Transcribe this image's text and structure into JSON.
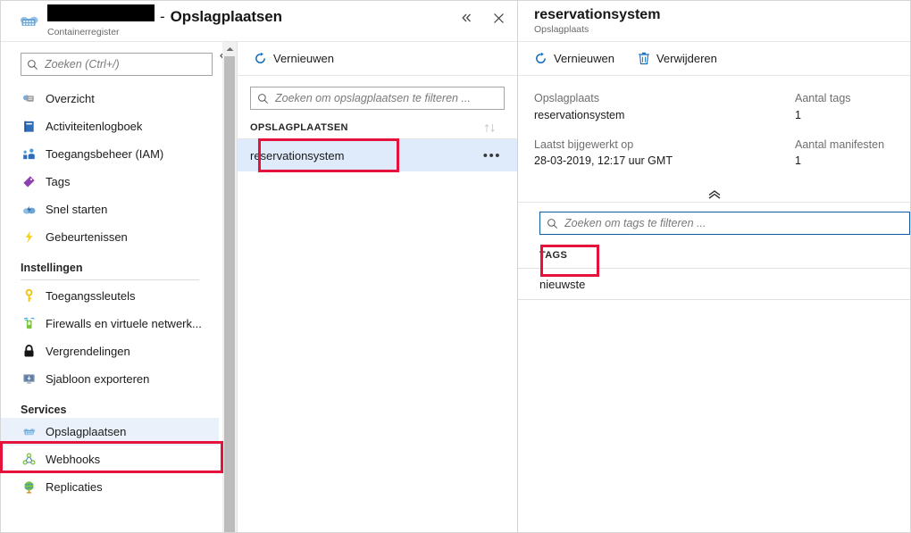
{
  "left_blade": {
    "header": {
      "icon": "container-registry-icon",
      "redacted_name": "",
      "separator": "-",
      "title": "Opslagplaatsen",
      "subtitle": "Containerregister",
      "collapse_label": "«",
      "close_label": "✕"
    },
    "menu": {
      "collapse_label": "«",
      "search": {
        "placeholder": "Zoeken (Ctrl+/)",
        "value": "",
        "icon": "search-icon"
      },
      "items": [
        {
          "label": "Overzicht",
          "icon": "overview-icon",
          "selected": false
        },
        {
          "label": "Activiteitenlogboek",
          "icon": "activity-log-icon",
          "selected": false
        },
        {
          "label": "Toegangsbeheer (IAM)",
          "icon": "access-control-icon",
          "selected": false
        },
        {
          "label": "Tags",
          "icon": "tag-icon",
          "selected": false
        },
        {
          "label": "Snel starten",
          "icon": "quickstart-icon",
          "selected": false
        },
        {
          "label": "Gebeurtenissen",
          "icon": "events-icon",
          "selected": false
        }
      ],
      "group_settings": "Instellingen",
      "settings_items": [
        {
          "label": "Toegangssleutels",
          "icon": "key-icon",
          "selected": false
        },
        {
          "label": "Firewalls en virtuele netwerk...",
          "icon": "firewall-icon",
          "selected": false
        },
        {
          "label": "Vergrendelingen",
          "icon": "lock-icon",
          "selected": false
        },
        {
          "label": "Sjabloon exporteren",
          "icon": "export-template-icon",
          "selected": false
        }
      ],
      "group_services": "Services",
      "services_items": [
        {
          "label": "Opslagplaatsen",
          "icon": "repositories-icon",
          "selected": true
        },
        {
          "label": "Webhooks",
          "icon": "webhooks-icon",
          "selected": false
        },
        {
          "label": "Replicaties",
          "icon": "replications-icon",
          "selected": false
        }
      ]
    },
    "repositories": {
      "toolbar": {
        "refresh_label": "Vernieuwen",
        "refresh_icon": "refresh-icon"
      },
      "search": {
        "placeholder": "Zoeken om opslagplaatsen te filteren ...",
        "value": "",
        "icon": "search-icon"
      },
      "column_header": "OPSLAGPLAATSEN",
      "sort_icon": "sort-updown-icon",
      "rows": [
        {
          "name": "reservationsystem",
          "menu_label": "•••",
          "selected": true
        }
      ]
    }
  },
  "right_blade": {
    "header": {
      "title": "reservationsystem",
      "subtitle": "Opslagplaats"
    },
    "toolbar": {
      "refresh_label": "Vernieuwen",
      "refresh_icon": "refresh-icon",
      "delete_label": "Verwijderen",
      "delete_icon": "trash-icon"
    },
    "properties": {
      "left": [
        {
          "label": "Opslagplaats",
          "value": "reservationsystem"
        },
        {
          "label": "Laatst bijgewerkt op",
          "value": "28-03-2019, 12:17 uur GMT"
        }
      ],
      "right": [
        {
          "label": "Aantal tags",
          "value": "1"
        },
        {
          "label": "Aantal manifesten",
          "value": "1"
        }
      ],
      "collapse_icon": "chevron-up-icon"
    },
    "tags": {
      "search": {
        "placeholder": "Zoeken om tags te filteren ...",
        "value": "",
        "icon": "search-icon"
      },
      "column_header": "TAGS",
      "rows": [
        {
          "name": "nieuwste"
        }
      ]
    }
  },
  "highlights": {
    "color": "#e5123b",
    "boxes": [
      "sidebar-opslagplaatsen",
      "repository-row-name",
      "tag-row-name"
    ]
  }
}
